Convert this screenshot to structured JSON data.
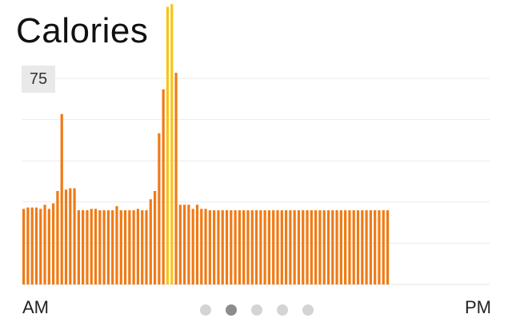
{
  "header": {
    "title": "Calories"
  },
  "chart_data": {
    "type": "bar",
    "y_tick_labels": [
      "75"
    ],
    "ylim": [
      0,
      100
    ],
    "x_start_label": "AM",
    "x_end_label": "PM",
    "grid": true,
    "colors": {
      "normal": "#f07a14",
      "peak": "#f5c518"
    },
    "values": [
      27.5,
      28,
      28,
      28,
      27.5,
      29,
      27.5,
      29.5,
      34,
      62,
      34.5,
      35,
      35,
      27,
      27,
      27,
      27.5,
      27.5,
      27,
      27,
      27,
      27,
      28.5,
      27,
      27,
      27,
      27,
      27.5,
      27,
      27,
      31,
      34,
      55,
      71,
      101,
      102,
      77,
      29,
      29,
      29,
      27.5,
      29,
      27.5,
      27.5,
      27,
      27,
      27,
      27,
      27,
      27,
      27,
      27,
      27,
      27,
      27,
      27,
      27,
      27,
      27,
      27,
      27,
      27,
      27,
      27,
      27,
      27,
      27,
      27,
      27,
      27,
      27,
      27,
      27,
      27,
      27,
      27,
      27,
      27,
      27,
      27,
      27,
      27,
      27,
      27,
      27,
      27,
      27
    ],
    "highlight_indices": [
      34,
      35
    ]
  },
  "pager": {
    "count": 5,
    "active_index": 1
  }
}
